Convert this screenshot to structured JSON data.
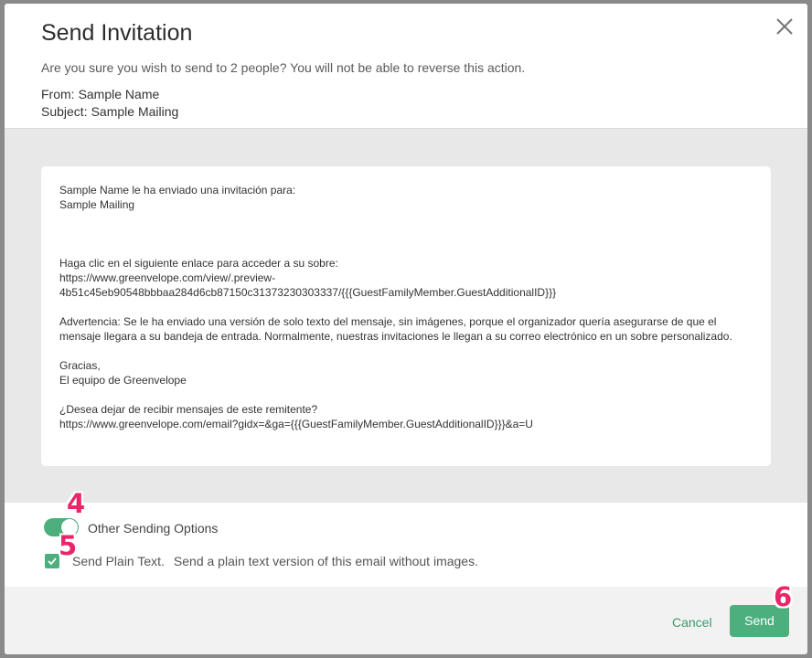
{
  "modal": {
    "title": "Send Invitation",
    "confirm_text": "Are you sure you wish to send to 2 people? You will not be able to reverse this action.",
    "from_label": "From:",
    "from_value": "Sample Name",
    "subject_label": "Subject:",
    "subject_value": "Sample Mailing",
    "close_icon": "close-icon"
  },
  "preview": {
    "line1": "Sample Name le ha enviado una invitación para:",
    "line2": "Sample Mailing",
    "click_text": "Haga clic en el siguiente enlace para acceder a su sobre:",
    "link_line1": "https://www.greenvelope.com/view/.preview-",
    "link_line2": "4b51c45eb90548bbbaa284d6cb87150c31373230303337/{{{GuestFamilyMember.GuestAdditionalID}}}",
    "warning": "Advertencia: Se le ha enviado una versión de solo texto del mensaje, sin imágenes, porque el organizador quería asegurarse de que el mensaje llegara a su bandeja de entrada. Normalmente, nuestras invitaciones le llegan a su correo electrónico en un sobre personalizado.",
    "thanks": "Gracias,",
    "team": "El equipo de Greenvelope",
    "unsubscribe_q": "¿Desea dejar de recibir mensajes de este remitente?",
    "unsubscribe_link": "https://www.greenvelope.com/email?gidx=&ga={{{GuestFamilyMember.GuestAdditionalID}}}&a=U"
  },
  "options": {
    "toggle_label": "Other Sending Options",
    "toggle_on": true,
    "checkbox_label": "Send Plain Text.",
    "checkbox_desc": "Send a plain text version of this email without images.",
    "checkbox_checked": true
  },
  "footer": {
    "cancel_label": "Cancel",
    "send_label": "Send"
  },
  "markers": {
    "m4": "4",
    "m5": "5",
    "m6": "6"
  },
  "colors": {
    "accent": "#4caf7d",
    "marker": "#e8266a"
  }
}
